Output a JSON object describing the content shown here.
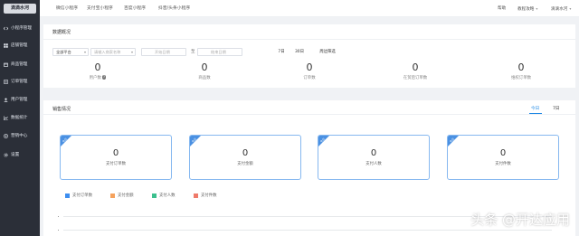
{
  "sidebar": {
    "logo": "滴滴水河",
    "items": [
      {
        "label": "小程序管理",
        "icon": "code-icon"
      },
      {
        "label": "店铺管理",
        "icon": "grid-icon"
      },
      {
        "label": "商品管理",
        "icon": "box-icon"
      },
      {
        "label": "订单管理",
        "icon": "document-icon"
      },
      {
        "label": "用户管理",
        "icon": "user-icon"
      },
      {
        "label": "数据统计",
        "icon": "chart-icon"
      },
      {
        "label": "营销中心",
        "icon": "target-icon"
      },
      {
        "label": "设置",
        "icon": "gear-icon"
      }
    ]
  },
  "topbar": {
    "tabs": [
      "微信小程序",
      "支付宝小程序",
      "百度小程序",
      "抖音/头条小程序"
    ],
    "help": "帮助",
    "tutorial": "教程攻略",
    "account": "滴滴水河"
  },
  "overview": {
    "title": "数据概况",
    "platform": "全部平台",
    "search_placeholder": "请输入商家名称",
    "start_date_placeholder": "开始日期",
    "date_separator": "至",
    "end_date_placeholder": "结束日期",
    "range_options": [
      "7日",
      "30日",
      "周边筛选"
    ],
    "stats": [
      {
        "value": "0",
        "label": "用户数"
      },
      {
        "value": "0",
        "label": "商品数"
      },
      {
        "value": "0",
        "label": "订单数"
      },
      {
        "value": "0",
        "label": "在贸后订单数"
      },
      {
        "value": "0",
        "label": "维权订单数"
      }
    ]
  },
  "sales": {
    "title": "销售情况",
    "tabs": [
      "今日",
      "7日"
    ],
    "kpis": [
      {
        "value": "0",
        "label": "支付订单数",
        "corner": "今日"
      },
      {
        "value": "0",
        "label": "支付金额",
        "corner": "今日"
      },
      {
        "value": "0",
        "label": "支付人数",
        "corner": "今日"
      },
      {
        "value": "0",
        "label": "支付件数",
        "corner": "今日"
      }
    ],
    "legend": [
      {
        "label": "支付订单数",
        "color": "#3d8ef0"
      },
      {
        "label": "支付金额",
        "color": "#f5a25d"
      },
      {
        "label": "支付人数",
        "color": "#3cc08e"
      },
      {
        "label": "支付件数",
        "color": "#ef7a6a"
      }
    ]
  },
  "watermark": "头条 @开达应用"
}
